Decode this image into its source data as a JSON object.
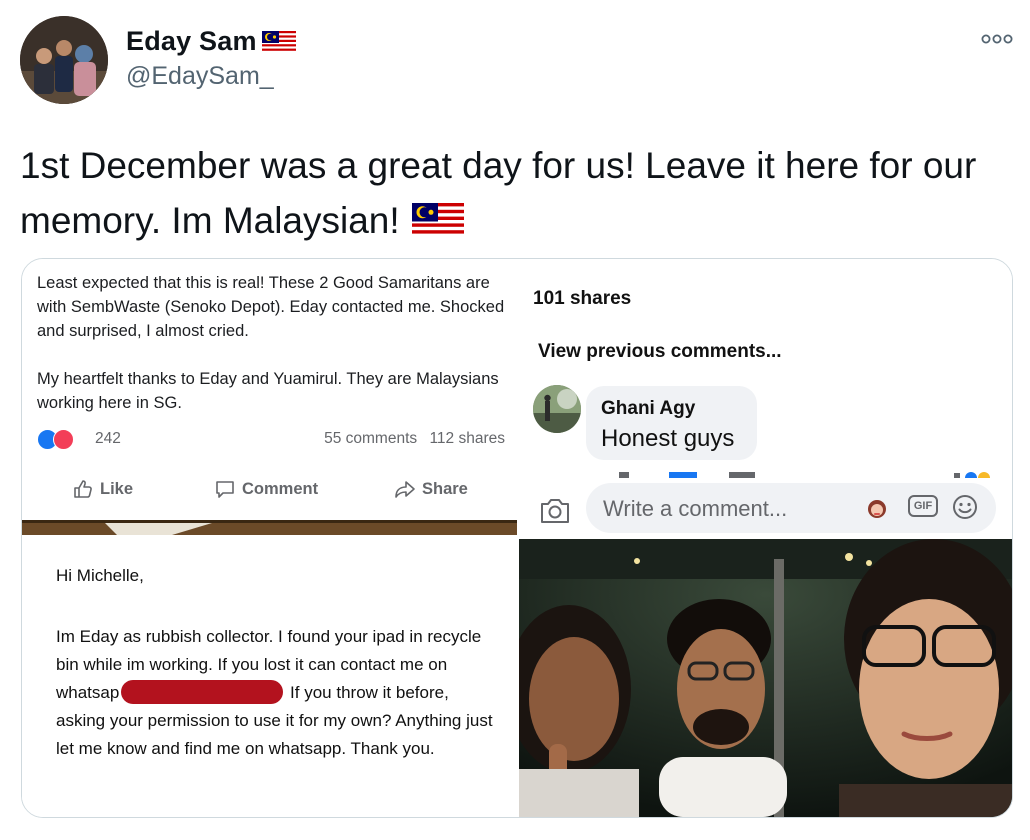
{
  "tweet": {
    "author_name": "Eday Sam",
    "handle": "@EdaySam_",
    "text": "1st December  was a great day for us! Leave it here for our memory. Im Malaysian!",
    "flag_icon": "malaysia-flag-icon",
    "more_icon": "more-dots-icon"
  },
  "fb_post": {
    "body": "Least expected that this is real!  These 2 Good Samaritans are with SembWaste (Senoko Depot). Eday contacted me. Shocked and surprised, I almost cried.\n\nMy heartfelt thanks to Eday and Yuamirul.  They are Malaysians working here in SG.",
    "reactions_count": "242",
    "comments": "55 comments",
    "shares": "112 shares",
    "actions": {
      "like": "Like",
      "comment": "Comment",
      "share": "Share"
    }
  },
  "email": {
    "greeting": "Hi Michelle,",
    "body_before": "Im Eday as rubbish collector. I found your ipad in recycle bin while im working. If you lost it can contact me on whatsap",
    "body_after": " If you throw it before, asking your permission to use it for my own? Anything just let me know and find me on whatsapp. Thank you."
  },
  "fb_comments": {
    "shares": "101 shares",
    "view_previous": "View previous comments...",
    "comment_author": "Ghani Agy",
    "comment_text": "Honest guys",
    "input_placeholder": "Write a comment...",
    "gif_label": "GIF"
  },
  "colors": {
    "text": "#0f1419",
    "secondary": "#536471",
    "fb_gray": "#65676b",
    "border": "#cfd9de",
    "redaction": "#b3121e"
  }
}
